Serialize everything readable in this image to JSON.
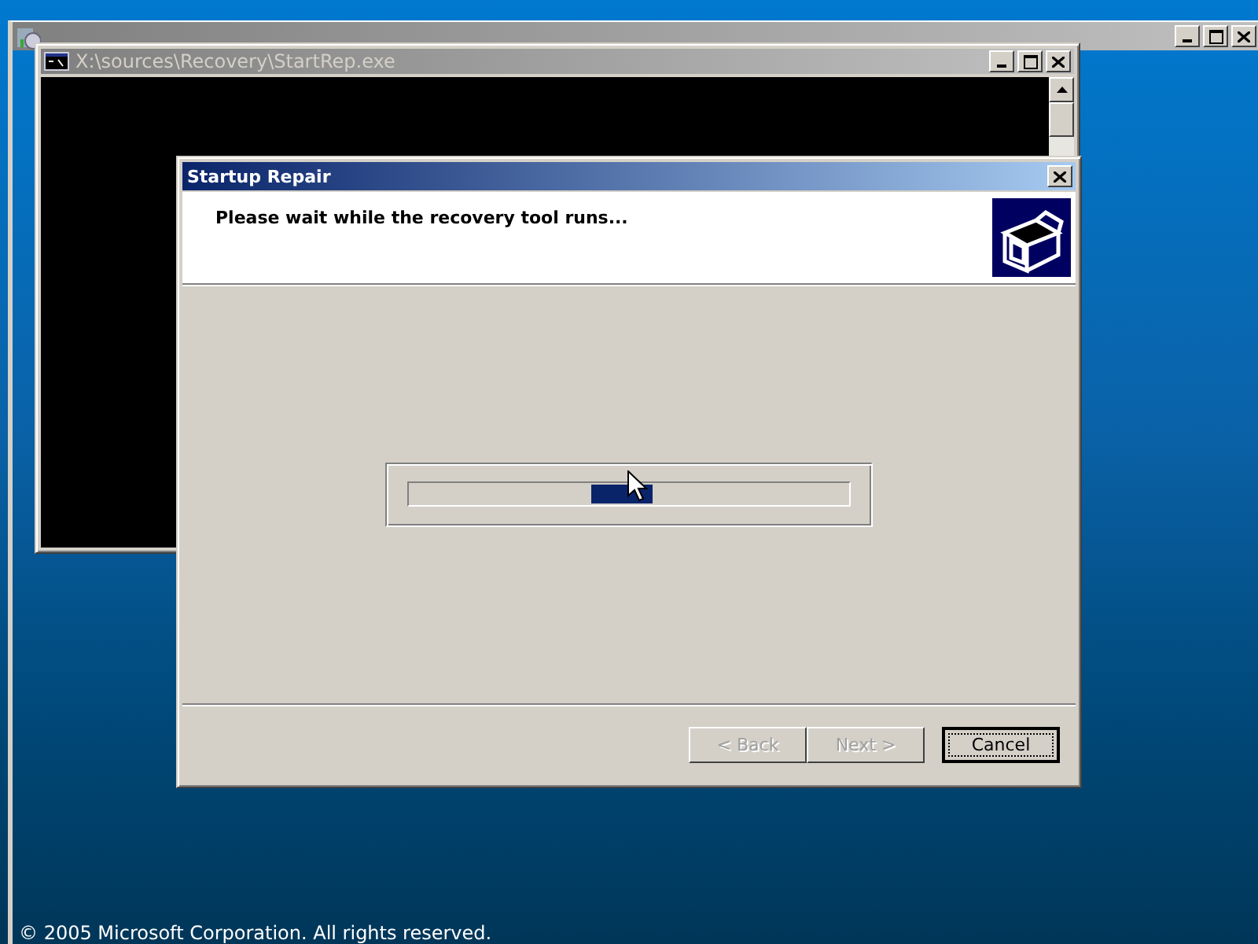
{
  "background_window": {
    "kind": "install"
  },
  "console_window": {
    "title": "X:\\sources\\Recovery\\StartRep.exe"
  },
  "dialog": {
    "title": "Startup Repair",
    "heading": "Please wait while the recovery tool runs...",
    "progress": {
      "kind": "marquee"
    },
    "buttons": [
      {
        "label": "< Back",
        "disabled": true,
        "default": false
      },
      {
        "label": "Next >",
        "disabled": true,
        "default": false
      },
      {
        "label": "Cancel",
        "disabled": false,
        "default": true
      }
    ]
  },
  "footer": "© 2005 Microsoft Corporation. All rights reserved."
}
